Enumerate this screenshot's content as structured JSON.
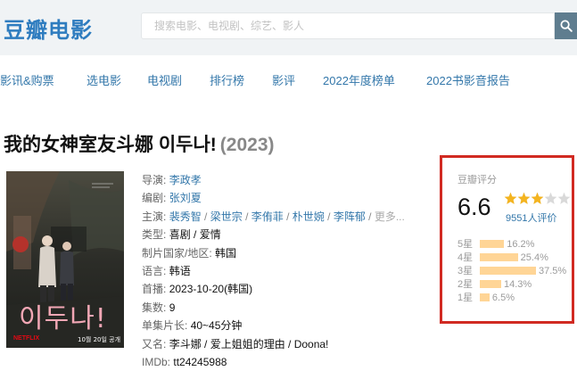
{
  "header": {
    "logo": "豆瓣电影",
    "search_placeholder": "搜索电影、电视剧、综艺、影人",
    "search_icon": "search-icon"
  },
  "nav": {
    "items": [
      "影讯&购票",
      "选电影",
      "电视剧",
      "排行榜",
      "影评",
      "2022年度榜单",
      "2022书影音报告"
    ]
  },
  "movie": {
    "title": "我的女神室友斗娜 이두나!",
    "year": "(2023)",
    "poster": {
      "title_text": "이두나!",
      "date_text": "10월 20일 공개",
      "brand": "NETFLIX"
    },
    "info": {
      "director_label": "导演:",
      "director": "李政孝",
      "writer_label": "编剧:",
      "writer": "张刘夏",
      "cast_label": "主演:",
      "cast": [
        "裴秀智",
        "梁世宗",
        "李侑菲",
        "朴世婉",
        "李阵郁"
      ],
      "cast_sep": " / ",
      "cast_more": "更多...",
      "genre_label": "类型:",
      "genre": "喜剧 / 爱情",
      "country_label": "制片国家/地区:",
      "country": "韩国",
      "language_label": "语言:",
      "language": "韩语",
      "release_label": "首播:",
      "release": "2023-10-20(韩国)",
      "episodes_label": "集数:",
      "episodes": "9",
      "runtime_label": "单集片长:",
      "runtime": "40~45分钟",
      "aka_label": "又名:",
      "aka": "李斗娜 / 爱上姐姐的理由 / Doona!",
      "imdb_label": "IMDb:",
      "imdb": "tt24245988"
    }
  },
  "rating": {
    "title": "豆瓣评分",
    "score": "6.6",
    "stars_value": 3.5,
    "count_text": "9551人评价",
    "bar_color": "#ffd596",
    "border_color": "#d12a22",
    "distribution": [
      {
        "label": "5星",
        "percent": 16.2,
        "text": "16.2%"
      },
      {
        "label": "4星",
        "percent": 25.4,
        "text": "25.4%"
      },
      {
        "label": "3星",
        "percent": 37.5,
        "text": "37.5%"
      },
      {
        "label": "2星",
        "percent": 14.3,
        "text": "14.3%"
      },
      {
        "label": "1星",
        "percent": 6.5,
        "text": "6.5%"
      }
    ]
  }
}
